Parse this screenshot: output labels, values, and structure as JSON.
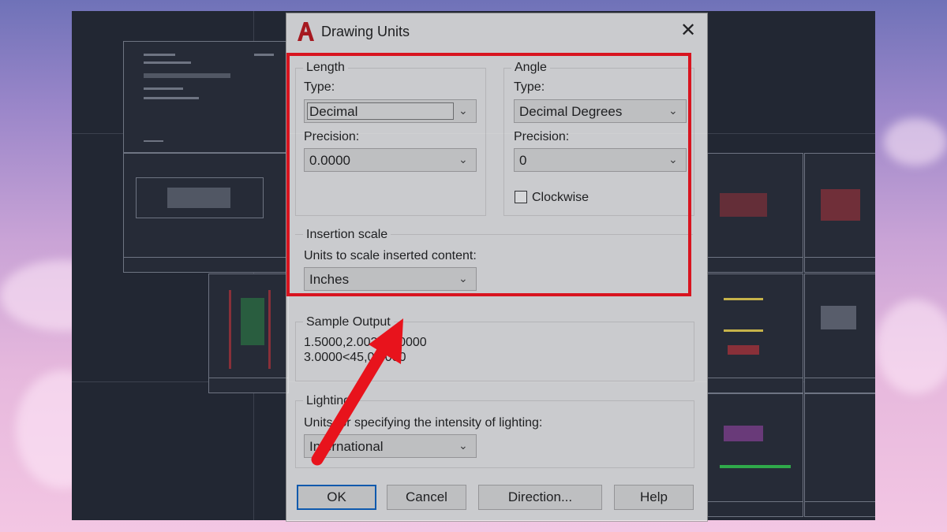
{
  "dialog": {
    "title": "Drawing Units",
    "close_symbol": "✕",
    "app_icon": "autocad-logo-icon",
    "accent_color": "#d8141f"
  },
  "length": {
    "group_label": "Length",
    "type_label": "Type:",
    "type_value": "Decimal",
    "precision_label": "Precision:",
    "precision_value": "0.0000"
  },
  "angle": {
    "group_label": "Angle",
    "type_label": "Type:",
    "type_value": "Decimal Degrees",
    "precision_label": "Precision:",
    "precision_value": "0",
    "clockwise_label": "Clockwise",
    "clockwise_checked": false
  },
  "insertion": {
    "group_label": "Insertion scale",
    "units_label": "Units to scale inserted content:",
    "units_value": "Inches"
  },
  "sample": {
    "group_label": "Sample Output",
    "line1": "1.5000,2.0039,0.0000",
    "line2": "3.0000<45,0.0000"
  },
  "lighting": {
    "group_label": "Lighting",
    "units_label": "Units for specifying the intensity of lighting:",
    "units_value": "International"
  },
  "buttons": {
    "ok": "OK",
    "cancel": "Cancel",
    "direction": "Direction...",
    "help": "Help"
  },
  "annotation": {
    "arrow_color": "#e8131c"
  }
}
